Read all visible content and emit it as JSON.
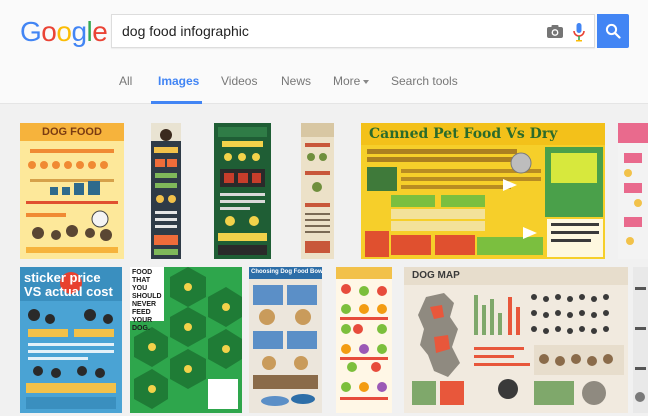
{
  "logo": {
    "letters": [
      {
        "char": "G",
        "color": "#4285f4"
      },
      {
        "char": "o",
        "color": "#ea4335"
      },
      {
        "char": "o",
        "color": "#fbbc05"
      },
      {
        "char": "g",
        "color": "#4285f4"
      },
      {
        "char": "l",
        "color": "#34a853"
      },
      {
        "char": "e",
        "color": "#ea4335"
      }
    ]
  },
  "search": {
    "query": "dog food infographic",
    "camera_icon": "camera-icon",
    "mic_icon": "mic-icon",
    "button_icon": "search-icon",
    "button_color": "#4285f4"
  },
  "nav": {
    "tabs": [
      {
        "label": "All",
        "active": false
      },
      {
        "label": "Images",
        "active": true
      },
      {
        "label": "Videos",
        "active": false
      },
      {
        "label": "News",
        "active": false
      },
      {
        "label": "More",
        "active": false
      },
      {
        "label": "Search tools",
        "active": false
      }
    ],
    "accent_color": "#4285f4"
  },
  "results": {
    "row1": [
      {
        "title": "DOG FOOD"
      },
      {
        "title": ""
      },
      {
        "title": ""
      },
      {
        "title": ""
      },
      {
        "title": "Canned Pet Food Vs Dry"
      },
      {
        "title": ""
      }
    ],
    "row2": [
      {
        "title": "sticker price VS actual cost"
      },
      {
        "title": "FOOD THAT YOU SHOULD NEVER FEED YOUR DOG."
      },
      {
        "title": "Choosing Dog Food Bowl"
      },
      {
        "title": ""
      },
      {
        "title": "DOG MAP"
      },
      {
        "title": ""
      }
    ]
  }
}
